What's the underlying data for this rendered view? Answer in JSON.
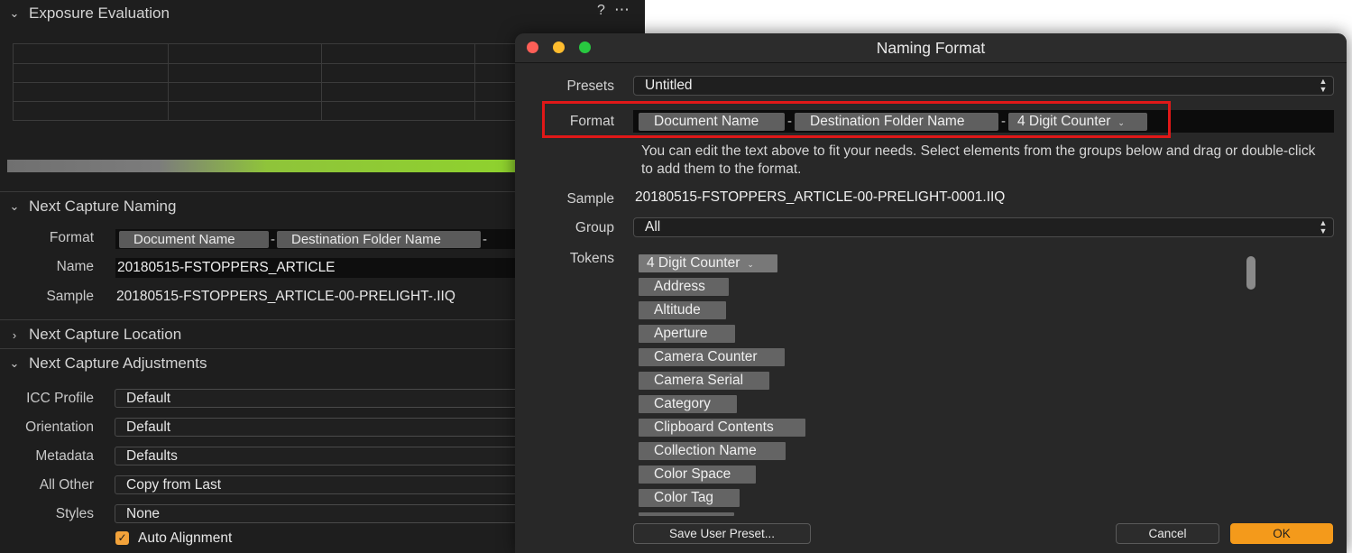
{
  "left_panel": {
    "exposure": {
      "title": "Exposure Evaluation",
      "help_icon": "?",
      "more_icon": "⋯"
    },
    "next_capture_naming": {
      "title": "Next Capture Naming",
      "format_label": "Format",
      "format_tokens": [
        "Document Name",
        "Destination Folder Name"
      ],
      "separator": "-",
      "name_label": "Name",
      "name_value": "20180515-FSTOPPERS_ARTICLE",
      "sample_label": "Sample",
      "sample_value": "20180515-FSTOPPERS_ARTICLE-00-PRELIGHT-.IIQ"
    },
    "next_capture_location": {
      "title": "Next Capture Location"
    },
    "next_capture_adjustments": {
      "title": "Next Capture Adjustments",
      "rows": [
        {
          "label": "ICC Profile",
          "value": "Default"
        },
        {
          "label": "Orientation",
          "value": "Default"
        },
        {
          "label": "Metadata",
          "value": "Defaults"
        },
        {
          "label": "All Other",
          "value": "Copy from Last"
        },
        {
          "label": "Styles",
          "value": "None"
        }
      ],
      "auto_alignment_label": "Auto Alignment",
      "auto_alignment_checked": true
    }
  },
  "dialog": {
    "title": "Naming Format",
    "traffic_lights": {
      "close": "#fe5f57",
      "minimize": "#febc2e",
      "zoom": "#28c840"
    },
    "presets_label": "Presets",
    "presets_value": "Untitled",
    "format_label": "Format",
    "format_tokens": [
      "Document Name",
      "Destination Folder Name"
    ],
    "format_counter_token": "4 Digit Counter",
    "separator": "-",
    "help_text": "You can edit the text above to fit your needs. Select elements from the groups below and drag or double-click to add them to the format.",
    "sample_label": "Sample",
    "sample_value": "20180515-FSTOPPERS_ARTICLE-00-PRELIGHT-0001.IIQ",
    "group_label": "Group",
    "group_value": "All",
    "tokens_label": "Tokens",
    "tokens_first": "4 Digit Counter",
    "tokens": [
      "Address",
      "Altitude",
      "Aperture",
      "Camera Counter",
      "Camera Serial",
      "Category",
      "Clipboard Contents",
      "Collection Name",
      "Color Space",
      "Color Tag"
    ],
    "save_preset_label": "Save User Preset...",
    "cancel_label": "Cancel",
    "ok_label": "OK",
    "accent_color": "#f49a1b",
    "highlight_color": "#e01818"
  }
}
